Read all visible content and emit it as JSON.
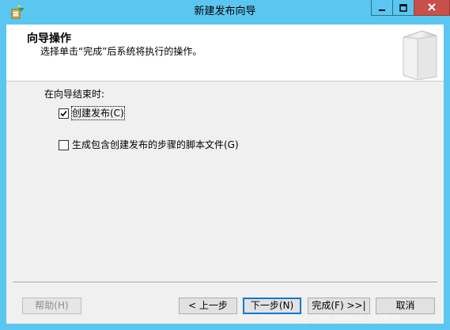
{
  "window": {
    "title": "新建发布向导",
    "titlebar_color": "#5bc6f0",
    "close_color": "#c7504b"
  },
  "header": {
    "title": "向导操作",
    "subtitle": "选择单击“完成”后系统将执行的操作。"
  },
  "body": {
    "label": "在向导结束时:",
    "options": [
      {
        "label": "创建发布(C)",
        "checked": true
      },
      {
        "label": "生成包含创建发布的步骤的脚本文件(G)",
        "checked": false
      }
    ]
  },
  "buttons": {
    "help": "帮助(H)",
    "back": "< 上一步",
    "next": "下一步(N)",
    "finish": "完成(F) >>|",
    "cancel": "取消"
  },
  "watermark": "https://blog.csdn.net/xyy_student",
  "icons": {
    "app": "wizard-app-icon",
    "minimize": "minimize-icon",
    "maximize": "maximize-icon",
    "close": "close-icon",
    "header": "wizard-book-icon",
    "check": "checkmark-icon"
  }
}
